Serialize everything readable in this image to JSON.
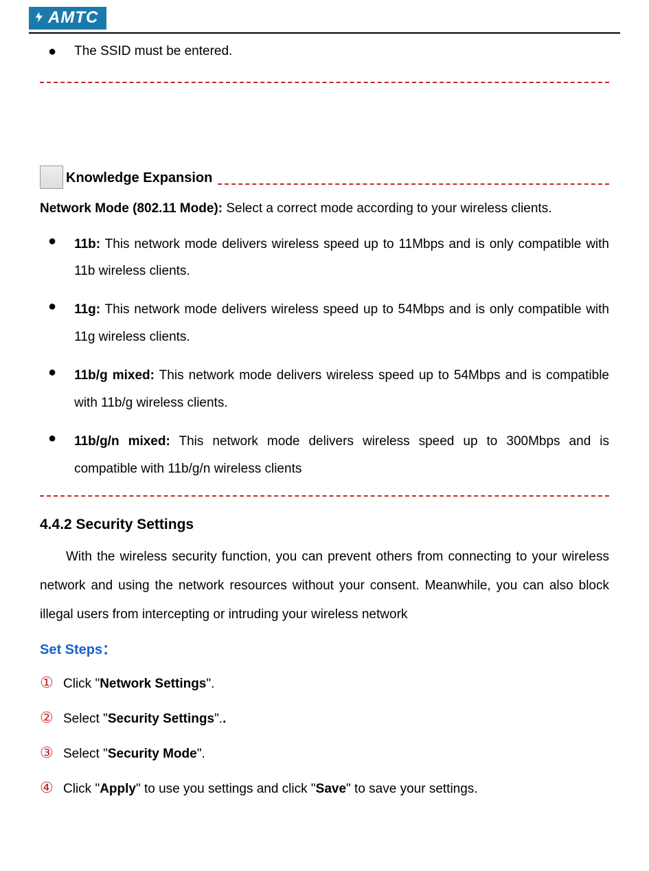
{
  "logo": {
    "text": "AMTC"
  },
  "topNote": {
    "text": "The SSID must be entered."
  },
  "knowledge": {
    "title": "Knowledge Expansion",
    "intro_label": "Network Mode (802.11 Mode):",
    "intro_text": " Select a correct mode according to your wireless clients.",
    "modes": [
      {
        "label": "11b:",
        "text": " This network mode delivers wireless speed up to 11Mbps and is only compatible with 11b wireless clients."
      },
      {
        "label": "11g:",
        "text": " This network mode delivers wireless speed up to 54Mbps and is only compatible with 11g wireless clients."
      },
      {
        "label": "11b/g mixed:",
        "text": " This network mode delivers wireless speed up to 54Mbps and is compatible with 11b/g wireless clients."
      },
      {
        "label": "11b/g/n mixed:",
        "text": " This network mode delivers wireless speed up to 300Mbps and is compatible with 11b/g/n wireless clients"
      }
    ]
  },
  "section": {
    "heading": "4.4.2 Security Settings",
    "intro": "With the wireless security function, you can prevent others from connecting to your wireless network and using the network resources without your consent. Meanwhile, you can also block illegal users from intercepting or intruding your wireless network",
    "set_steps_label": "Set Steps：",
    "steps": [
      {
        "num": "①",
        "pre": "Click \"",
        "bold": "Network Settings",
        "post": "\"."
      },
      {
        "num": "②",
        "pre": "Select \"",
        "bold": "Security Settings",
        "post": "\"."
      },
      {
        "num": "③",
        "pre": "Select \"",
        "bold": "Security Mode",
        "post": "\"."
      },
      {
        "num": "④",
        "pre": "Click \"",
        "bold": "Apply",
        "mid": "\" to use you settings and click \"",
        "bold2": "Save",
        "post2": "\" to save your settings."
      }
    ]
  }
}
